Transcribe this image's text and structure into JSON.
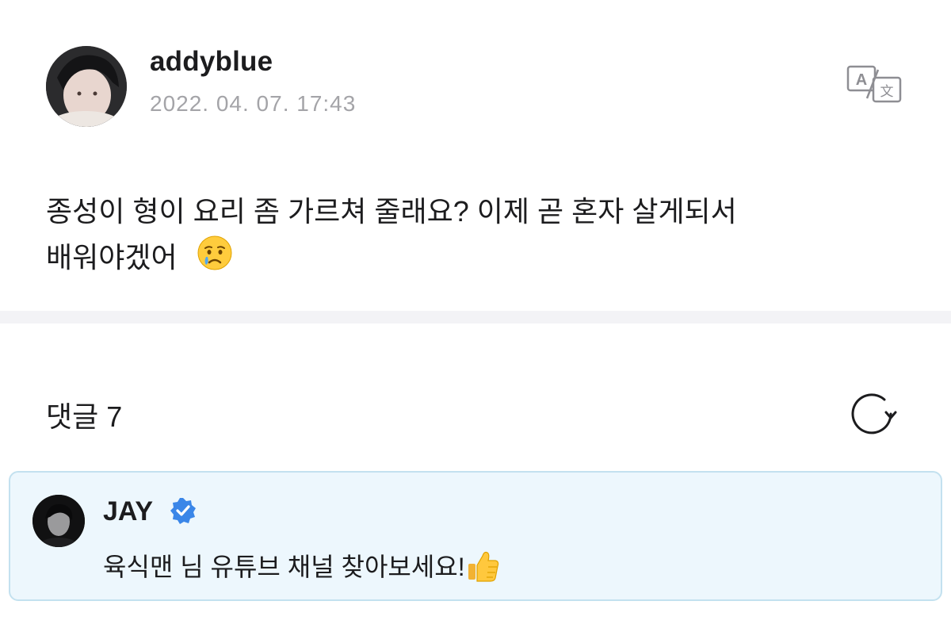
{
  "post": {
    "author": "addyblue",
    "date": "2022. 04. 07. 17:43",
    "text_line1": "종성이 형이 요리 좀 가르쳐 줄래요? 이제 곧 혼자 살게되서",
    "text_line2": "배워야겠어",
    "emoji": "crying-face-icon",
    "translate_icon": "translate-icon"
  },
  "comments": {
    "label": "댓글 7",
    "refresh_icon": "refresh-icon",
    "items": [
      {
        "author": "JAY",
        "verified": true,
        "text": "육식맨 님 유튜브 채널 찾아보세요!",
        "emoji": "thumbs-up-icon"
      }
    ]
  },
  "colors": {
    "comment_bg": "#edf7fd",
    "comment_border": "#c3e1ef",
    "verified_blue": "#3a86e8",
    "date_gray": "#a4a4a8"
  }
}
